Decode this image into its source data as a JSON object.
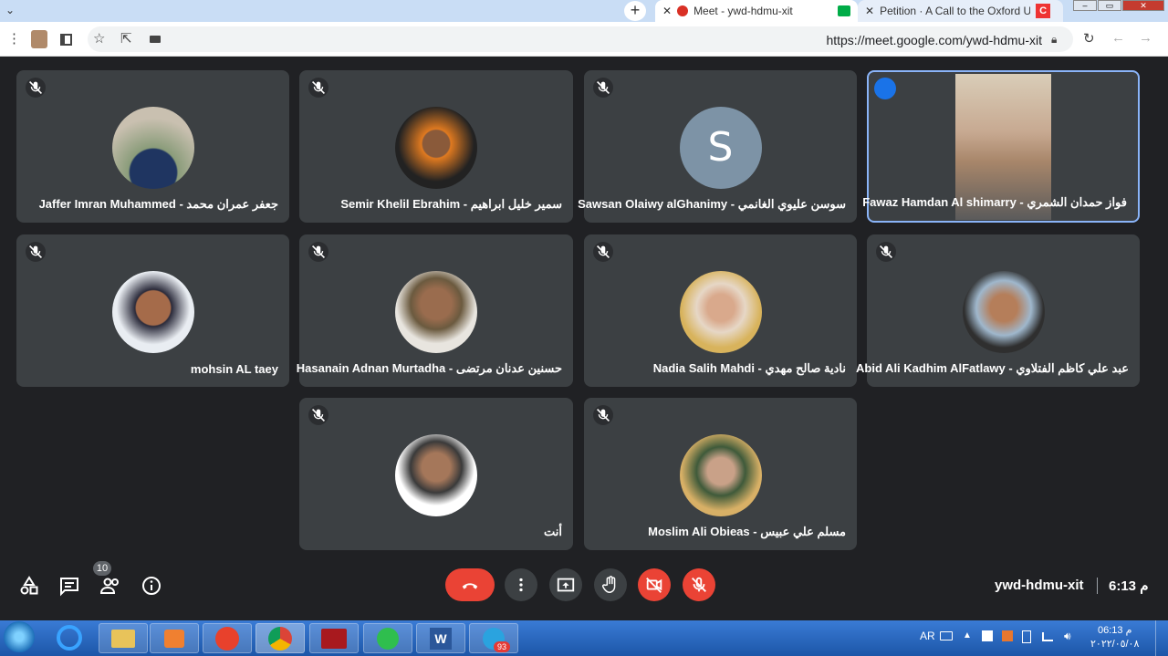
{
  "browser": {
    "tabs": [
      {
        "label": "Meet - ywd-hdmu-xit"
      },
      {
        "label": "Petition · A Call to the Oxford Un"
      }
    ],
    "url": "https://meet.google.com/ywd-hdmu-xit"
  },
  "participants": [
    {
      "name": "Jaffer Imran Muhammed - جعفر عمران محمد"
    },
    {
      "name": "Semir Khelil Ebrahim - سمير خليل ابراهيم"
    },
    {
      "name": "Sawsan Olaiwy alGhanimy - سوسن عليوي الغانمي",
      "initial": "S"
    },
    {
      "name": "Fawaz Hamdan Al shimarry - فواز حمدان الشمري"
    },
    {
      "name": "mohsin AL taey"
    },
    {
      "name": "Hasanain Adnan Murtadha - حسنين عدنان مرتضى"
    },
    {
      "name": "Nadia Salih Mahdi - نادية صالح مهدي"
    },
    {
      "name": "Abid Ali Kadhim AlFatlawy - عبد علي كاظم الفتلاوي"
    },
    {
      "name": "أنت"
    },
    {
      "name": "Moslim Ali Obieas - مسلم علي عبيس"
    }
  ],
  "controls": {
    "participant_count": "10",
    "meeting_code": "ywd-hdmu-xit",
    "time": "6:13 م"
  },
  "taskbar": {
    "lang": "AR",
    "time": "06:13 م",
    "date": "٢٠٢٢/٠٥/٠٨",
    "telegram_badge": "93"
  }
}
